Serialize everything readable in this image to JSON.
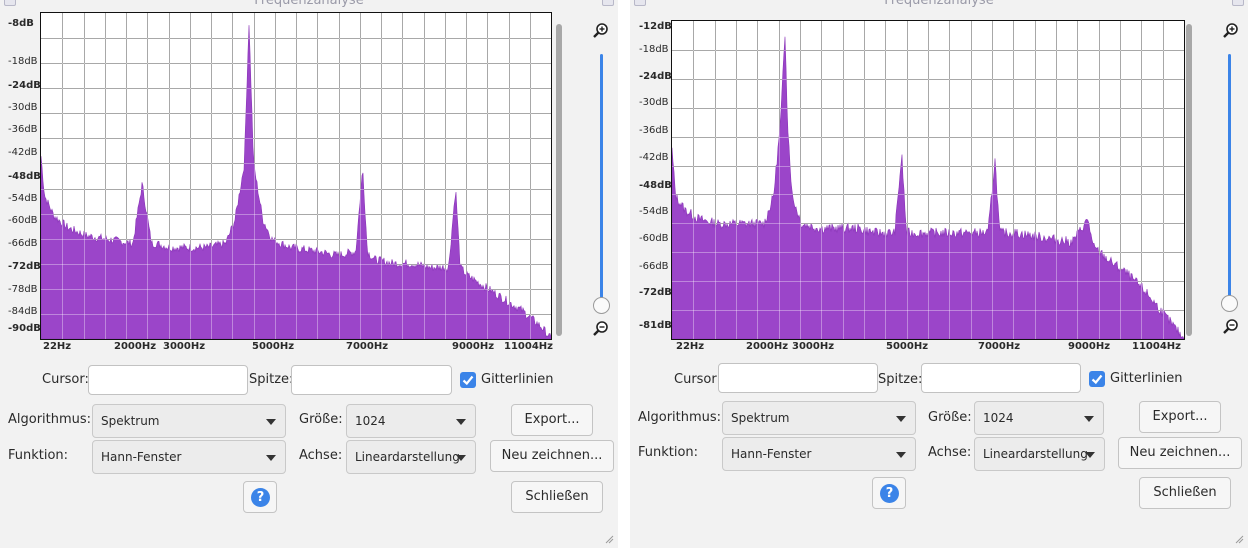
{
  "app": {
    "window_title": "Frequenzanalyse"
  },
  "left": {
    "y_labels": [
      {
        "text": "-8dB",
        "bold": true
      },
      {
        "text": "-18dB",
        "bold": false
      },
      {
        "text": "-24dB",
        "bold": true
      },
      {
        "text": "-30dB",
        "bold": false
      },
      {
        "text": "-36dB",
        "bold": false
      },
      {
        "text": "-42dB",
        "bold": false
      },
      {
        "text": "-48dB",
        "bold": true
      },
      {
        "text": "-54dB",
        "bold": false
      },
      {
        "text": "-60dB",
        "bold": false
      },
      {
        "text": "-66dB",
        "bold": false
      },
      {
        "text": "-72dB",
        "bold": true
      },
      {
        "text": "-78dB",
        "bold": false
      },
      {
        "text": "-84dB",
        "bold": false
      },
      {
        "text": "-90dB",
        "bold": true
      }
    ],
    "x_labels": [
      "22Hz",
      "2000Hz",
      "3000Hz",
      "5000Hz",
      "7000Hz",
      "9000Hz",
      "11004Hz"
    ],
    "chart_data": {
      "type": "area",
      "xlabel": "",
      "ylabel": "",
      "xlim": [
        22,
        11004
      ],
      "ylim": [
        -90,
        -8
      ],
      "grid": true,
      "fill_color": "#9b45c9",
      "x": [
        22,
        100,
        300,
        600,
        1000,
        1500,
        2000,
        2200,
        2400,
        2500,
        2800,
        3200,
        3600,
        4000,
        4200,
        4400,
        4500,
        4600,
        4800,
        5000,
        5400,
        6000,
        6400,
        6800,
        6950,
        7050,
        7200,
        7600,
        8000,
        8400,
        8800,
        8950,
        9050,
        9200,
        9600,
        10000,
        10400,
        10800,
        11004
      ],
      "y": [
        -44,
        -54,
        -59,
        -62,
        -64,
        -65,
        -66,
        -51,
        -66,
        -66,
        -67,
        -67,
        -67,
        -66,
        -60,
        -46,
        -10,
        -46,
        -60,
        -65,
        -67,
        -68,
        -69,
        -68,
        -47,
        -68,
        -70,
        -71,
        -71,
        -72,
        -72,
        -52,
        -72,
        -74,
        -77,
        -80,
        -83,
        -87,
        -90
      ]
    },
    "form": {
      "cursor_label": "Cursor:",
      "cursor_value": "",
      "peak_label": "Spitze:",
      "peak_value": "",
      "grid_checkbox_label": "Gitterlinien",
      "algorithm_label": "Algorithmus:",
      "algorithm_value": "Spektrum",
      "size_label": "Größe:",
      "size_value": "1024",
      "export_label": "Export...",
      "function_label": "Funktion:",
      "function_value": "Hann-Fenster",
      "axis_label": "Achse:",
      "axis_value": "Lineardarstellung",
      "replot_label": "Neu zeichnen...",
      "close_label": "Schließen",
      "help_glyph": "?"
    }
  },
  "right": {
    "y_labels": [
      {
        "text": "-12dB",
        "bold": true
      },
      {
        "text": "-18dB",
        "bold": false
      },
      {
        "text": "-24dB",
        "bold": true
      },
      {
        "text": "-30dB",
        "bold": false
      },
      {
        "text": "-36dB",
        "bold": false
      },
      {
        "text": "-42dB",
        "bold": false
      },
      {
        "text": "-48dB",
        "bold": true
      },
      {
        "text": "-54dB",
        "bold": false
      },
      {
        "text": "-60dB",
        "bold": false
      },
      {
        "text": "-66dB",
        "bold": false
      },
      {
        "text": "-72dB",
        "bold": true
      },
      {
        "text": "-81dB",
        "bold": true
      }
    ],
    "x_labels": [
      "22Hz",
      "2000Hz",
      "3000Hz",
      "5000Hz",
      "7000Hz",
      "9000Hz",
      "11004Hz"
    ],
    "chart_data": {
      "type": "area",
      "xlabel": "",
      "ylabel": "",
      "xlim": [
        22,
        11004
      ],
      "ylim": [
        -81,
        -12
      ],
      "grid": true,
      "fill_color": "#9b45c9",
      "x": [
        22,
        100,
        300,
        600,
        1000,
        1500,
        2000,
        2200,
        2350,
        2450,
        2500,
        2600,
        2800,
        3200,
        3600,
        4000,
        4400,
        4800,
        4950,
        5050,
        5400,
        6000,
        6400,
        6800,
        6950,
        7050,
        7400,
        8000,
        8600,
        8950,
        9050,
        9400,
        9800,
        10200,
        10600,
        11004
      ],
      "y": [
        -40,
        -50,
        -53,
        -55,
        -56,
        -56,
        -56,
        -50,
        -34,
        -14,
        -34,
        -50,
        -56,
        -57,
        -57,
        -57,
        -58,
        -58,
        -41,
        -58,
        -58,
        -58,
        -58,
        -58,
        -42,
        -58,
        -58,
        -59,
        -60,
        -55,
        -61,
        -64,
        -67,
        -71,
        -76,
        -81
      ]
    },
    "form": {
      "cursor_label": "Cursor:",
      "cursor_value": "",
      "peak_label": "Spitze:",
      "peak_value": "",
      "grid_checkbox_label": "Gitterlinien",
      "algorithm_label": "Algorithmus:",
      "algorithm_value": "Spektrum",
      "size_label": "Größe:",
      "size_value": "1024",
      "export_label": "Export...",
      "function_label": "Funktion:",
      "function_value": "Hann-Fenster",
      "axis_label": "Achse:",
      "axis_value": "Lineardarstellung",
      "replot_label": "Neu zeichnen...",
      "close_label": "Schließen",
      "help_glyph": "?"
    }
  }
}
